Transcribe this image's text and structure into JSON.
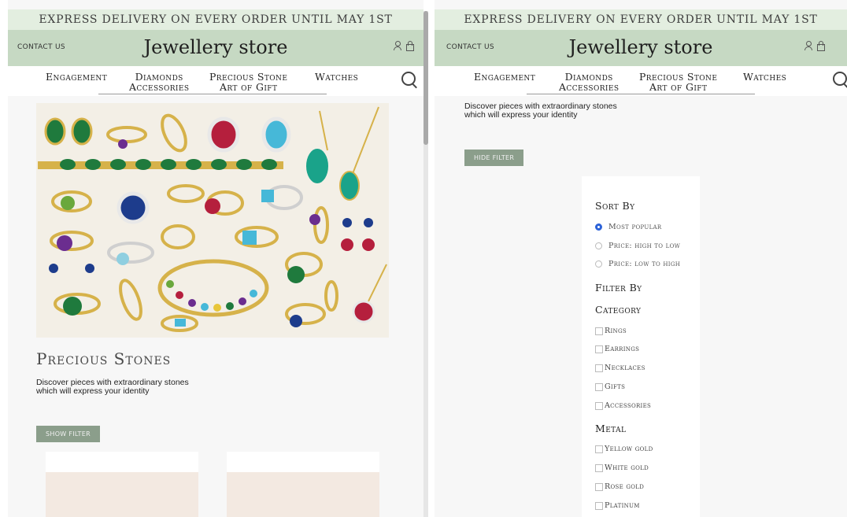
{
  "promo_text": "Express delivery on every order until May 1st",
  "header": {
    "contact": "Contact us",
    "title": "Jewellery store"
  },
  "nav": {
    "items": [
      {
        "label": "Engagement"
      },
      {
        "label": "Diamonds\nAccessories"
      },
      {
        "label": "Precious Stone\nArt of Gift"
      },
      {
        "label": "Watches"
      }
    ]
  },
  "left": {
    "section_title": "Precious Stones",
    "description": "Discover pieces with extraordinary stones which will express your identity",
    "show_filter": "Show filter"
  },
  "right": {
    "description": "Discover pieces with extraordinary stones which will express your identity",
    "hide_filter": "Hide filter",
    "sort_by": "Sort By",
    "sort_options": [
      {
        "label": "Most popular",
        "checked": true
      },
      {
        "label": "Price: high to low",
        "checked": false
      },
      {
        "label": "Price: low to high",
        "checked": false
      }
    ],
    "filter_by": "Filter By",
    "category_heading": "Category",
    "categories": [
      "Rings",
      "Earrings",
      "Necklaces",
      "Gifts",
      "Accessories"
    ],
    "metal_heading": "Metal",
    "metals": [
      "Yellow gold",
      "White gold",
      "Rose gold",
      "Platinum"
    ]
  },
  "colors": {
    "promo_bg": "#e3eee0",
    "header_bg": "#c6d9c3",
    "button_bg": "#8b9e8b",
    "radio_selected": "#2d63d8"
  }
}
